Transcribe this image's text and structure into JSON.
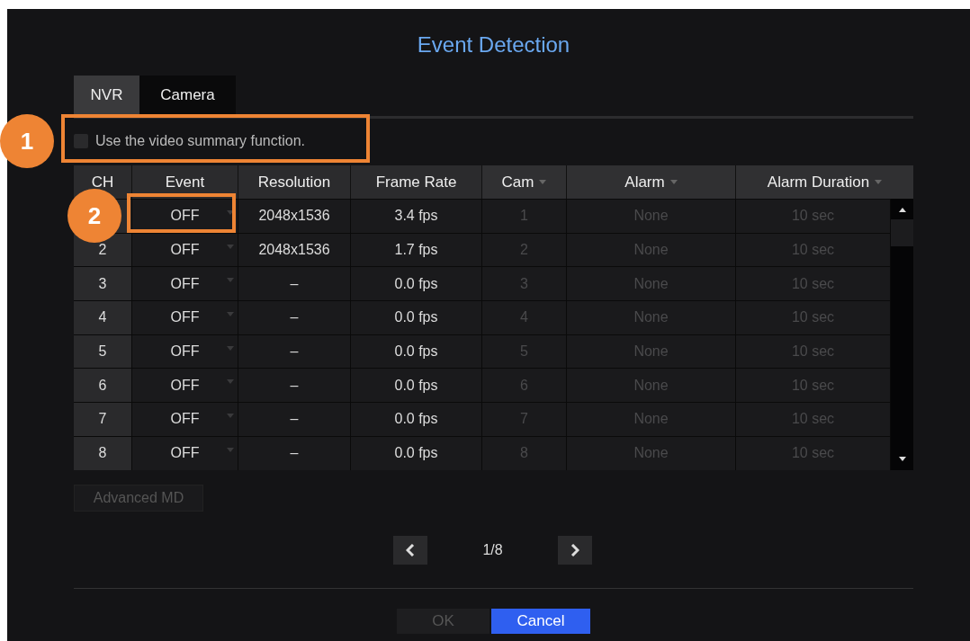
{
  "window": {
    "title": "Event Detection"
  },
  "tabs": [
    {
      "label": "NVR",
      "selected": true
    },
    {
      "label": "Camera",
      "selected": false
    }
  ],
  "option": {
    "label": "Use the video summary function.",
    "checked": false
  },
  "table": {
    "columns": [
      {
        "label": "CH",
        "dropdown": false,
        "disabled": false
      },
      {
        "label": "Event",
        "dropdown": false,
        "disabled": false
      },
      {
        "label": "Resolution",
        "dropdown": false,
        "disabled": false
      },
      {
        "label": "Frame Rate",
        "dropdown": false,
        "disabled": false
      },
      {
        "label": "Cam",
        "dropdown": true,
        "disabled": true
      },
      {
        "label": "Alarm",
        "dropdown": true,
        "disabled": true
      },
      {
        "label": "Alarm Duration",
        "dropdown": true,
        "disabled": true
      }
    ],
    "rows": [
      {
        "cells": [
          null,
          "OFF",
          "2048x1536",
          "3.4 fps",
          "1",
          "None",
          "10 sec"
        ]
      },
      {
        "cells": [
          "2",
          "OFF",
          "2048x1536",
          "1.7 fps",
          "2",
          "None",
          "10 sec"
        ]
      },
      {
        "cells": [
          "3",
          "OFF",
          "–",
          "0.0 fps",
          "3",
          "None",
          "10 sec"
        ]
      },
      {
        "cells": [
          "4",
          "OFF",
          "–",
          "0.0 fps",
          "4",
          "None",
          "10 sec"
        ]
      },
      {
        "cells": [
          "5",
          "OFF",
          "–",
          "0.0 fps",
          "5",
          "None",
          "10 sec"
        ]
      },
      {
        "cells": [
          "6",
          "OFF",
          "–",
          "0.0 fps",
          "6",
          "None",
          "10 sec"
        ]
      },
      {
        "cells": [
          "7",
          "OFF",
          "–",
          "0.0 fps",
          "7",
          "None",
          "10 sec"
        ]
      },
      {
        "cells": [
          "8",
          "OFF",
          "–",
          "0.0 fps",
          "8",
          "None",
          "10 sec"
        ]
      }
    ]
  },
  "advanced_button": {
    "label": "Advanced MD",
    "disabled": true
  },
  "pager": {
    "page": "1/8"
  },
  "buttons": [
    {
      "label": "OK",
      "disabled": true,
      "primary": false
    },
    {
      "label": "Cancel",
      "disabled": false,
      "primary": true
    }
  ],
  "callouts": [
    {
      "number": "1"
    },
    {
      "number": "2"
    }
  ]
}
